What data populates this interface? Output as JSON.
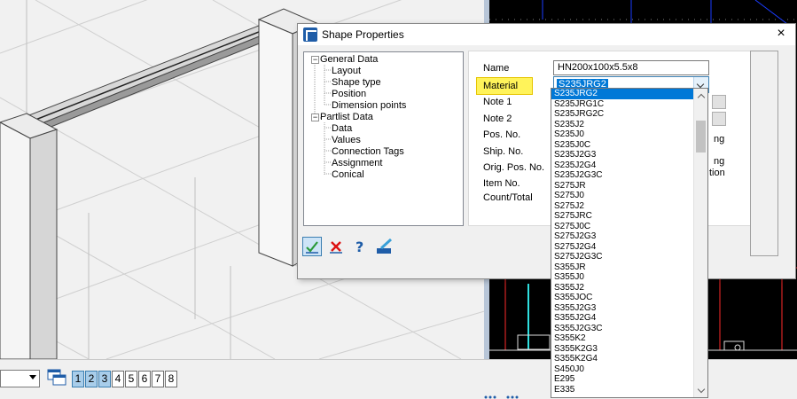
{
  "dialog": {
    "title": "Shape Properties",
    "close_label": "×"
  },
  "tree": {
    "items": [
      {
        "label": "General Data",
        "level": 0,
        "toggle": "−"
      },
      {
        "label": "Layout",
        "level": 1
      },
      {
        "label": "Shape type",
        "level": 1
      },
      {
        "label": "Position",
        "level": 1
      },
      {
        "label": "Dimension points",
        "level": 1
      },
      {
        "label": "Partlist Data",
        "level": 0,
        "toggle": "−"
      },
      {
        "label": "Data",
        "level": 1
      },
      {
        "label": "Values",
        "level": 1
      },
      {
        "label": "Connection Tags",
        "level": 1
      },
      {
        "label": "Assignment",
        "level": 1
      },
      {
        "label": "Conical",
        "level": 1
      }
    ]
  },
  "props": {
    "name_label": "Name",
    "name_value": "HN200x100x5.5x8",
    "material_label": "Material",
    "material_value": "S235JRG2",
    "note1_label": "Note 1",
    "note2_label": "Note 2",
    "pos_no_label": "Pos. No.",
    "ship_no_label": "Ship. No.",
    "orig_pos_no_label": "Orig. Pos. No.",
    "item_no_label": "Item No.",
    "count_total_label": "Count/Total",
    "partial_texts": [
      "ng",
      "ng",
      "tion"
    ]
  },
  "dropdown": {
    "options": [
      "S235JRG2",
      "S235JRG1C",
      "S235JRG2C",
      "S235J2",
      "S235J0",
      "S235J0C",
      "S235J2G3",
      "S235J2G4",
      "S235J2G3C",
      "S275JR",
      "S275J0",
      "S275J2",
      "S275JRC",
      "S275J0C",
      "S275J2G3",
      "S275J2G4",
      "S275J2G3C",
      "S355JR",
      "S355J0",
      "S355J2",
      "S355JOC",
      "S355J2G3",
      "S355J2G4",
      "S355J2G3C",
      "S355K2",
      "S355K2G3",
      "S355K2G4",
      "S450J0",
      "E295",
      "E335"
    ],
    "selected_index": 0
  },
  "toolbar": {
    "buttons": [
      "ok-check-icon",
      "cancel-x-icon",
      "help-question-icon",
      "edit-brush-icon"
    ]
  },
  "bottombar": {
    "page_tabs": [
      "1",
      "2",
      "3",
      "4",
      "5",
      "6",
      "7",
      "8"
    ],
    "active_tabs": [
      0,
      1,
      2
    ]
  },
  "colors": {
    "selection": "#0078d7",
    "highlight_yellow": "#fff35a",
    "viewport_bg": "#f1f1f1",
    "cad_bg": "#000000"
  }
}
